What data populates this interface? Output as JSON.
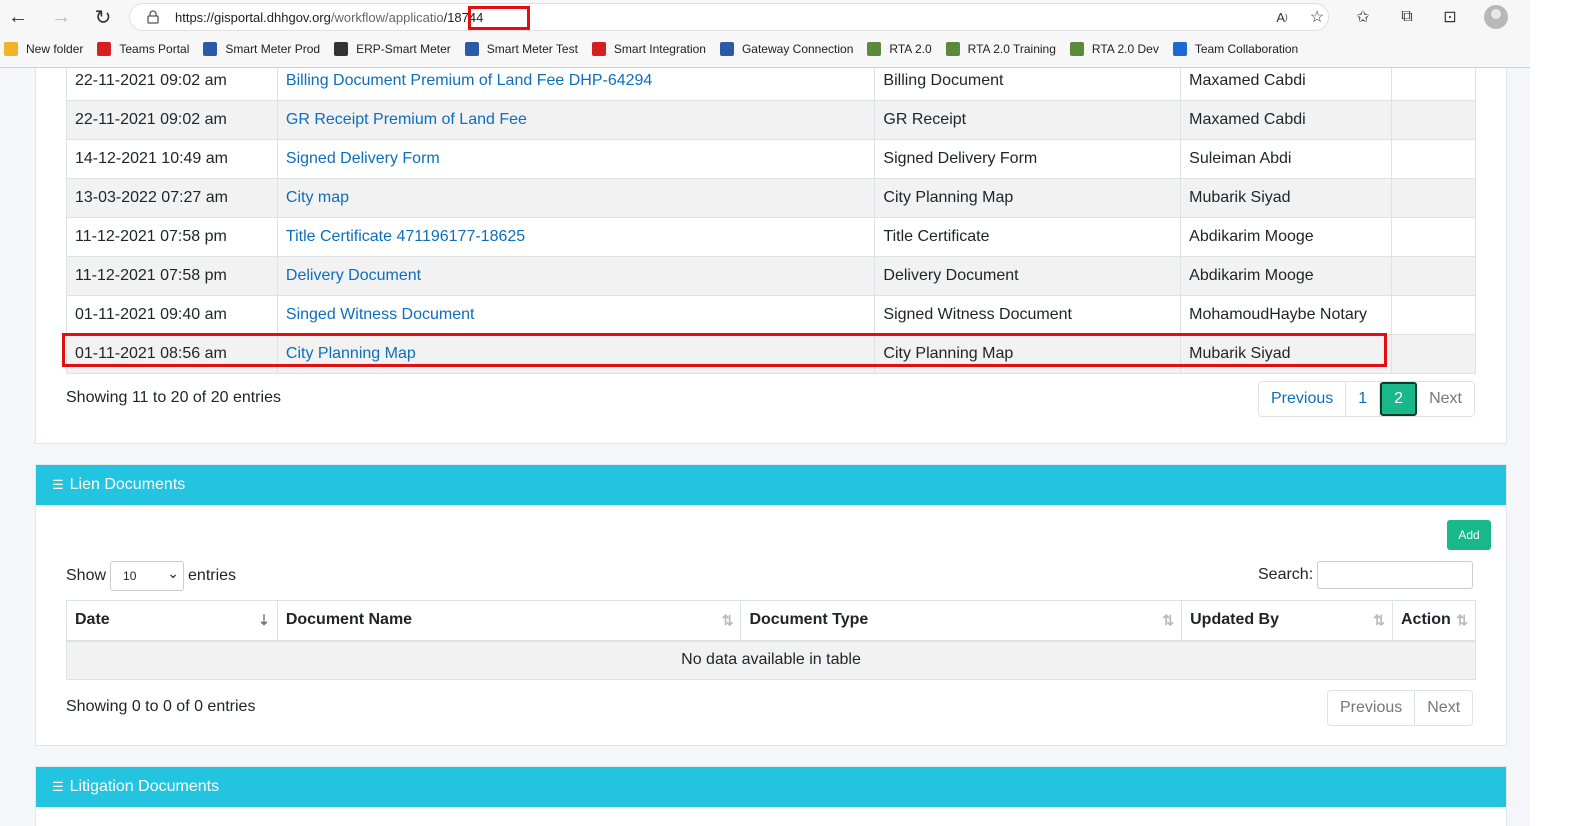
{
  "browser": {
    "url_host": "https://gisportal.dhhgov.org",
    "url_path": "/workflow/applicatio",
    "url_id": "/18744",
    "bookmarks": [
      {
        "label": "New folder",
        "color": "#f0b428"
      },
      {
        "label": "Teams Portal",
        "color": "#d42020"
      },
      {
        "label": "Smart Meter Prod",
        "color": "#2a5aa8"
      },
      {
        "label": "ERP-Smart Meter",
        "color": "#333333"
      },
      {
        "label": "Smart Meter Test",
        "color": "#2a5aa8"
      },
      {
        "label": "Smart Integration",
        "color": "#d42020"
      },
      {
        "label": "Gateway Connection",
        "color": "#2a5aa8"
      },
      {
        "label": "RTA 2.0",
        "color": "#5a8a3a"
      },
      {
        "label": "RTA 2.0 Training",
        "color": "#5a8a3a"
      },
      {
        "label": "RTA 2.0 Dev",
        "color": "#5a8a3a"
      },
      {
        "label": "Team Collaboration",
        "color": "#1a6ad0"
      }
    ]
  },
  "documents": {
    "rows": [
      {
        "date": "22-11-2021 09:02 am",
        "name": "Billing Document Premium of Land Fee DHP-64294",
        "type": "Billing Document",
        "by": "Maxamed Cabdi"
      },
      {
        "date": "22-11-2021 09:02 am",
        "name": "GR Receipt Premium of Land Fee",
        "type": "GR Receipt",
        "by": "Maxamed Cabdi"
      },
      {
        "date": "14-12-2021 10:49 am",
        "name": "Signed Delivery Form",
        "type": "Signed Delivery Form",
        "by": "Suleiman Abdi"
      },
      {
        "date": "13-03-2022 07:27 am",
        "name": "City map",
        "type": "City Planning Map",
        "by": "Mubarik Siyad"
      },
      {
        "date": "11-12-2021 07:58 pm",
        "name": "Title Certificate 471196177-18625",
        "type": "Title Certificate",
        "by": "Abdikarim Mooge"
      },
      {
        "date": "11-12-2021 07:58 pm",
        "name": "Delivery Document",
        "type": "Delivery Document",
        "by": "Abdikarim Mooge"
      },
      {
        "date": "01-11-2021 09:40 am",
        "name": "Singed Witness Document",
        "type": "Signed Witness Document",
        "by": "MohamoudHaybe Notary"
      },
      {
        "date": "01-11-2021 08:56 am",
        "name": "City Planning Map",
        "type": "City Planning Map",
        "by": "Mubarik Siyad"
      }
    ],
    "info": "Showing 11 to 20 of 20 entries",
    "pager": {
      "previous": "Previous",
      "page1": "1",
      "page2": "2",
      "next": "Next"
    }
  },
  "lien": {
    "title": "Lien Documents",
    "add_label": "Add",
    "show_label": "Show",
    "show_value": "10",
    "entries_label": "entries",
    "search_label": "Search:",
    "columns": {
      "date": "Date",
      "name": "Document Name",
      "type": "Document Type",
      "by": "Updated By",
      "action": "Action"
    },
    "no_data": "No data available in table",
    "info": "Showing 0 to 0 of 0 entries",
    "pager": {
      "previous": "Previous",
      "next": "Next"
    }
  },
  "litigation": {
    "title": "Litigation Documents"
  }
}
